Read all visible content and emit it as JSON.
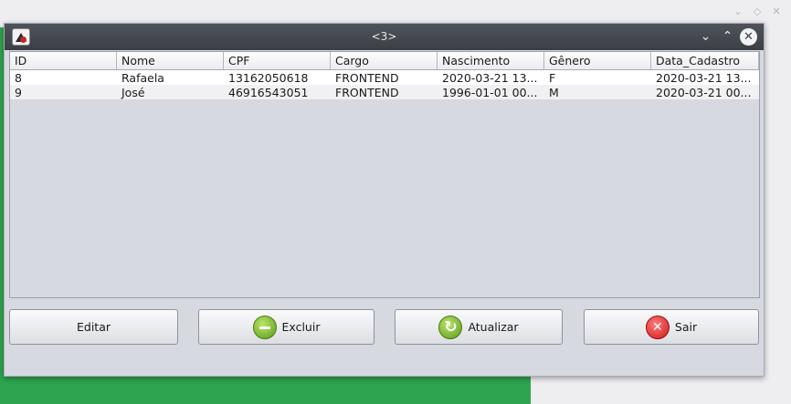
{
  "window": {
    "title": "<3>",
    "controls": {
      "minimize_icon": "chevron-down-icon",
      "maximize_icon": "chevron-up-icon",
      "close_icon": "close-icon"
    }
  },
  "table": {
    "columns": [
      "ID",
      "Nome",
      "CPF",
      "Cargo",
      "Nascimento",
      "Gênero",
      "Data_Cadastro"
    ],
    "rows": [
      [
        "8",
        "Rafaela",
        "13162050618",
        "FRONTEND",
        "2020-03-21 13...",
        "F",
        "2020-03-21 13..."
      ],
      [
        "9",
        "José",
        "46916543051",
        "FRONTEND",
        "1996-01-01 00...",
        "M",
        "2020-03-21 00..."
      ]
    ]
  },
  "buttons": {
    "editar": {
      "label": "Editar"
    },
    "excluir": {
      "label": "Excluir",
      "icon": "minus-icon"
    },
    "atualizar": {
      "label": "Atualizar",
      "icon": "refresh-icon"
    },
    "sair": {
      "label": "Sair",
      "icon": "close-icon"
    }
  },
  "colors": {
    "desktop_green": "#2ea44f",
    "titlebar": "#3b3f45",
    "panel": "#d6d9e0"
  }
}
